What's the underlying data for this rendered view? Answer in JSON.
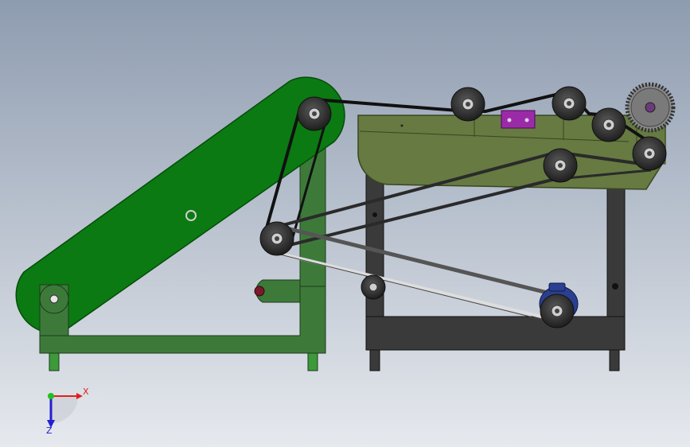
{
  "viewport": {
    "background_top": "#8e9cb0",
    "background_bottom": "#e6e9ee"
  },
  "colors": {
    "conveyor_green": "#0b7a12",
    "conveyor_green_dark": "#0a5a10",
    "frame_green": "#3d7a3a",
    "frame_green_dark": "#2a5a28",
    "machine_olive": "#667a42",
    "machine_olive_dark": "#4a5a2e",
    "stand_dark": "#3a3a3a",
    "pulley_dark": "#2e2e2e",
    "belt_black": "#111111",
    "motor_blue": "#2a3f8f",
    "bracket_purple": "#9b2aa8",
    "pin_red": "#7a1a2a"
  },
  "triad": {
    "x_label": "X",
    "z_label": "Z",
    "x_color": "#e02020",
    "y_color": "#20c020",
    "z_color": "#2020d0"
  }
}
